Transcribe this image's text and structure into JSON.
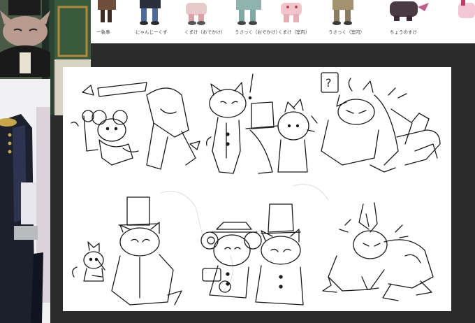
{
  "reference_strip": {
    "labels": [
      "ー執事",
      "にゃんじーくず",
      "くまけ（おでかけ）",
      "うさっく（おでかけ）",
      "くまけ（室内）",
      "うさっく（室内）",
      "ちょうのすけ"
    ]
  },
  "canvas": {
    "panels": [
      {
        "name": "panel-1"
      },
      {
        "name": "panel-2"
      },
      {
        "name": "panel-3"
      },
      {
        "name": "panel-4"
      },
      {
        "name": "panel-5"
      },
      {
        "name": "panel-6"
      }
    ]
  },
  "colors": {
    "workspace": "#2b2b2b",
    "canvas": "#ffffff",
    "ink": "#1a1a1a",
    "guide": "#d9d9d9"
  }
}
